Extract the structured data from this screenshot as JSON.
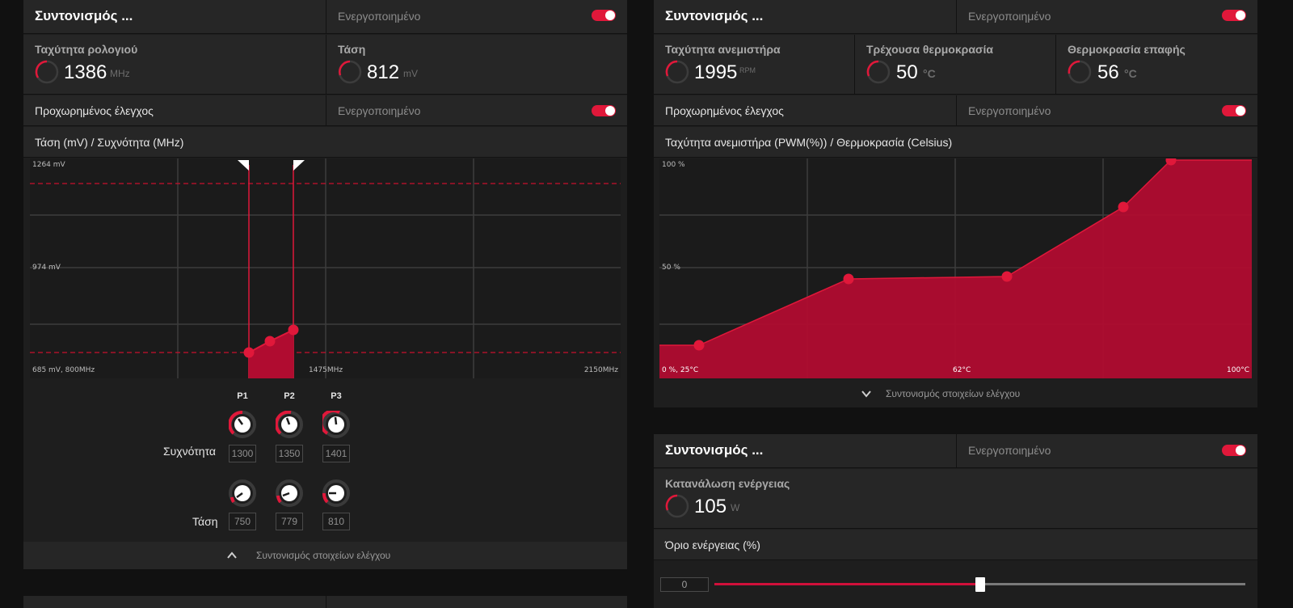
{
  "left_panel": {
    "header": {
      "title": "Συντονισμός ...",
      "state": "Ενεργοποιημένο",
      "toggle_on": true
    },
    "metrics": [
      {
        "label": "Ταχύτητα ρολογιού",
        "value": "1386",
        "unit": "MHz"
      },
      {
        "label": "Τάση",
        "value": "812",
        "unit": "mV"
      }
    ],
    "advanced": {
      "label": "Προχωρημένος έλεγχος",
      "state": "Ενεργοποιημένο",
      "toggle_on": true
    },
    "graph_title": "Τάση (mV) / Συχνότητα (MHz)",
    "axis_labels": {
      "top": "1264 mV",
      "mid": "974 mV",
      "bottom_left": "685 mV, 800MHz",
      "bottom_mid": "1475MHz",
      "bottom_right": "2150MHz"
    },
    "pstates": [
      "P1",
      "P2",
      "P3"
    ],
    "freq_row_label": "Συχνότητα",
    "volt_row_label": "Τάση",
    "freq_values": [
      "1300",
      "1350",
      "1401"
    ],
    "volt_values": [
      "750",
      "779",
      "810"
    ],
    "footer": "Συντονισμός στοιχείων ελέγχου"
  },
  "right_top_panel": {
    "header": {
      "title": "Συντονισμός ...",
      "state": "Ενεργοποιημένο",
      "toggle_on": true
    },
    "metrics": [
      {
        "label": "Ταχύτητα ανεμιστήρα",
        "value": "1995",
        "unit": "RPM"
      },
      {
        "label": "Τρέχουσα θερμοκρασία",
        "value": "50",
        "unit": "°C"
      },
      {
        "label": "Θερμοκρασία επαφής",
        "value": "56",
        "unit": "°C"
      }
    ],
    "advanced": {
      "label": "Προχωρημένος έλεγχος",
      "state": "Ενεργοποιημένο",
      "toggle_on": true
    },
    "graph_title": "Ταχύτητα ανεμιστήρα (PWM(%)) / Θερμοκρασία (Celsius)",
    "axis_labels": {
      "top": "100 %",
      "mid": "50 %",
      "bottom_left": "0 %, 25°C",
      "bottom_mid": "62°C",
      "bottom_right": "100°C"
    },
    "footer": "Συντονισμός στοιχείων ελέγχου"
  },
  "right_bottom_panel": {
    "header": {
      "title": "Συντονισμός ...",
      "state": "Ενεργοποιημένο",
      "toggle_on": true
    },
    "metric": {
      "label": "Κατανάλωση ενέργειας",
      "value": "105",
      "unit": "W"
    },
    "power_limit_label": "Όριο ενέργειας (%)",
    "power_limit_value": "0",
    "slider_fraction": 0.5
  },
  "colors": {
    "accent": "#e0183a",
    "fill": "#b00c30",
    "panel": "#262626",
    "background": "#111111"
  }
}
